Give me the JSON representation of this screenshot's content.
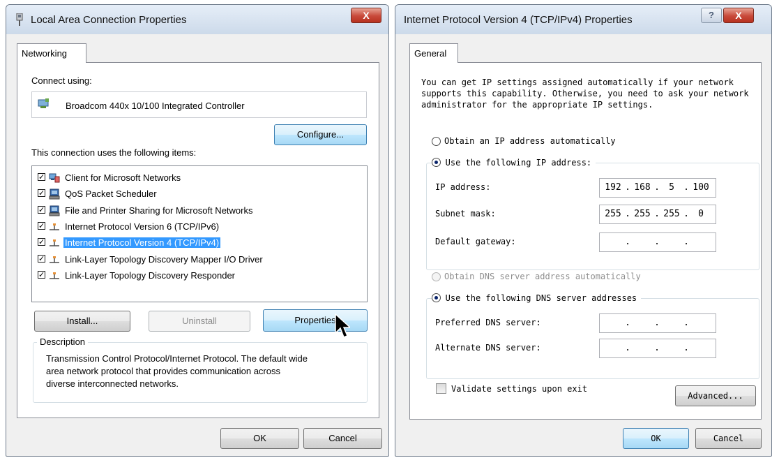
{
  "lan": {
    "title": "Local Area Connection Properties",
    "close_glyph": "X",
    "tab": "Networking",
    "connect_using_label": "Connect using:",
    "adapter": "Broadcom 440x 10/100 Integrated Controller",
    "configure_label": "Configure...",
    "items_label": "This connection uses the following items:",
    "items": [
      {
        "label": "Client for Microsoft Networks",
        "checked": true,
        "icon": "network-client-icon"
      },
      {
        "label": "QoS Packet Scheduler",
        "checked": true,
        "icon": "service-icon"
      },
      {
        "label": "File and Printer Sharing for Microsoft Networks",
        "checked": true,
        "icon": "service-icon"
      },
      {
        "label": "Internet Protocol Version 6 (TCP/IPv6)",
        "checked": true,
        "icon": "protocol-icon"
      },
      {
        "label": "Internet Protocol Version 4 (TCP/IPv4)",
        "checked": true,
        "icon": "protocol-icon",
        "selected": true
      },
      {
        "label": "Link-Layer Topology Discovery Mapper I/O Driver",
        "checked": true,
        "icon": "protocol-icon"
      },
      {
        "label": "Link-Layer Topology Discovery Responder",
        "checked": true,
        "icon": "protocol-icon"
      }
    ],
    "install_label": "Install...",
    "uninstall_label": "Uninstall",
    "properties_label": "Properties",
    "description_label": "Description",
    "description_lines": [
      "Transmission Control Protocol/Internet Protocol. The default wide",
      "area network protocol that provides communication across",
      "diverse interconnected networks."
    ],
    "ok_label": "OK",
    "cancel_label": "Cancel"
  },
  "ipv4": {
    "title": "Internet Protocol Version 4 (TCP/IPv4) Properties",
    "help_glyph": "?",
    "close_glyph": "X",
    "tab": "General",
    "intro_lines": [
      "You can get IP settings assigned automatically if your network",
      "supports this capability. Otherwise, you need to ask your network",
      "administrator for the appropriate IP settings."
    ],
    "auto_ip_label": "Obtain an IP address automatically",
    "manual_ip_label": "Use the following IP address:",
    "ip_address_label": "IP address:",
    "ip_address": [
      "192",
      "168",
      "5",
      "100"
    ],
    "subnet_label": "Subnet mask:",
    "subnet_mask": [
      "255",
      "255",
      "255",
      "0"
    ],
    "gateway_label": "Default gateway:",
    "auto_dns_label": "Obtain DNS server address automatically",
    "manual_dns_label": "Use the following DNS server addresses",
    "preferred_dns_label": "Preferred DNS server:",
    "alternate_dns_label": "Alternate DNS server:",
    "empty_ip_dots": ".",
    "validate_label": "Validate settings upon exit",
    "advanced_label": "Advanced...",
    "ok_label": "OK",
    "cancel_label": "Cancel"
  }
}
